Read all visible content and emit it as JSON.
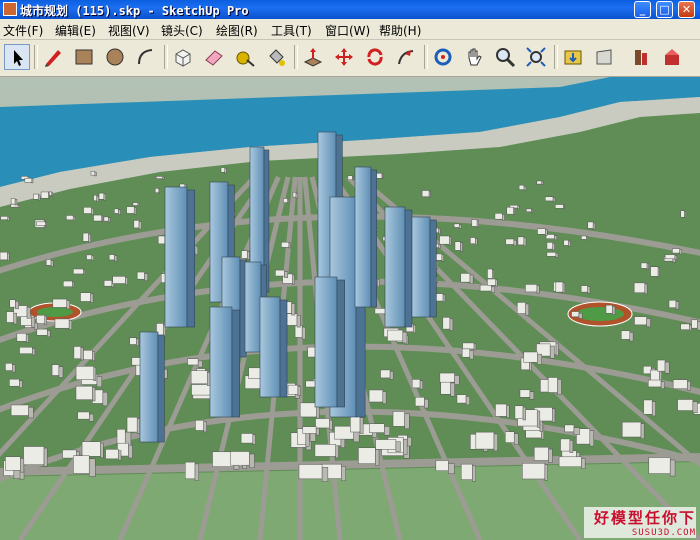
{
  "window": {
    "title": "城市规划 (115).skp - SketchUp Pro",
    "minimize": "_",
    "maximize": "□",
    "close": "✕"
  },
  "menu": [
    "文件(F)",
    "编辑(E)",
    "视图(V)",
    "镜头(C)",
    "绘图(R)",
    "工具(T)",
    "窗口(W)",
    "帮助(H)"
  ],
  "toolbar": {
    "tools": [
      "select-icon",
      "pencil-icon",
      "rectangle-icon",
      "circle-icon",
      "arc-icon",
      "make-component-icon",
      "eraser-icon",
      "tape-measure-icon",
      "paint-bucket-icon",
      "push-pull-icon",
      "move-icon",
      "rotate-icon",
      "follow-me-icon",
      "orbit-icon",
      "pan-icon",
      "zoom-icon",
      "zoom-extents-icon",
      "get-models-icon",
      "share-model-icon",
      "component-library-icon",
      "extension-icon"
    ]
  },
  "watermark": {
    "line1": "好模型任你下",
    "line2": "SUSU3D.COM"
  },
  "colors": {
    "water": "#2a8fb8",
    "grass": "#5f8d55",
    "road": "#9c9c94",
    "building": "#ecece6",
    "tower": "#8fb3cf",
    "titlebar": "#0a5fe0"
  }
}
